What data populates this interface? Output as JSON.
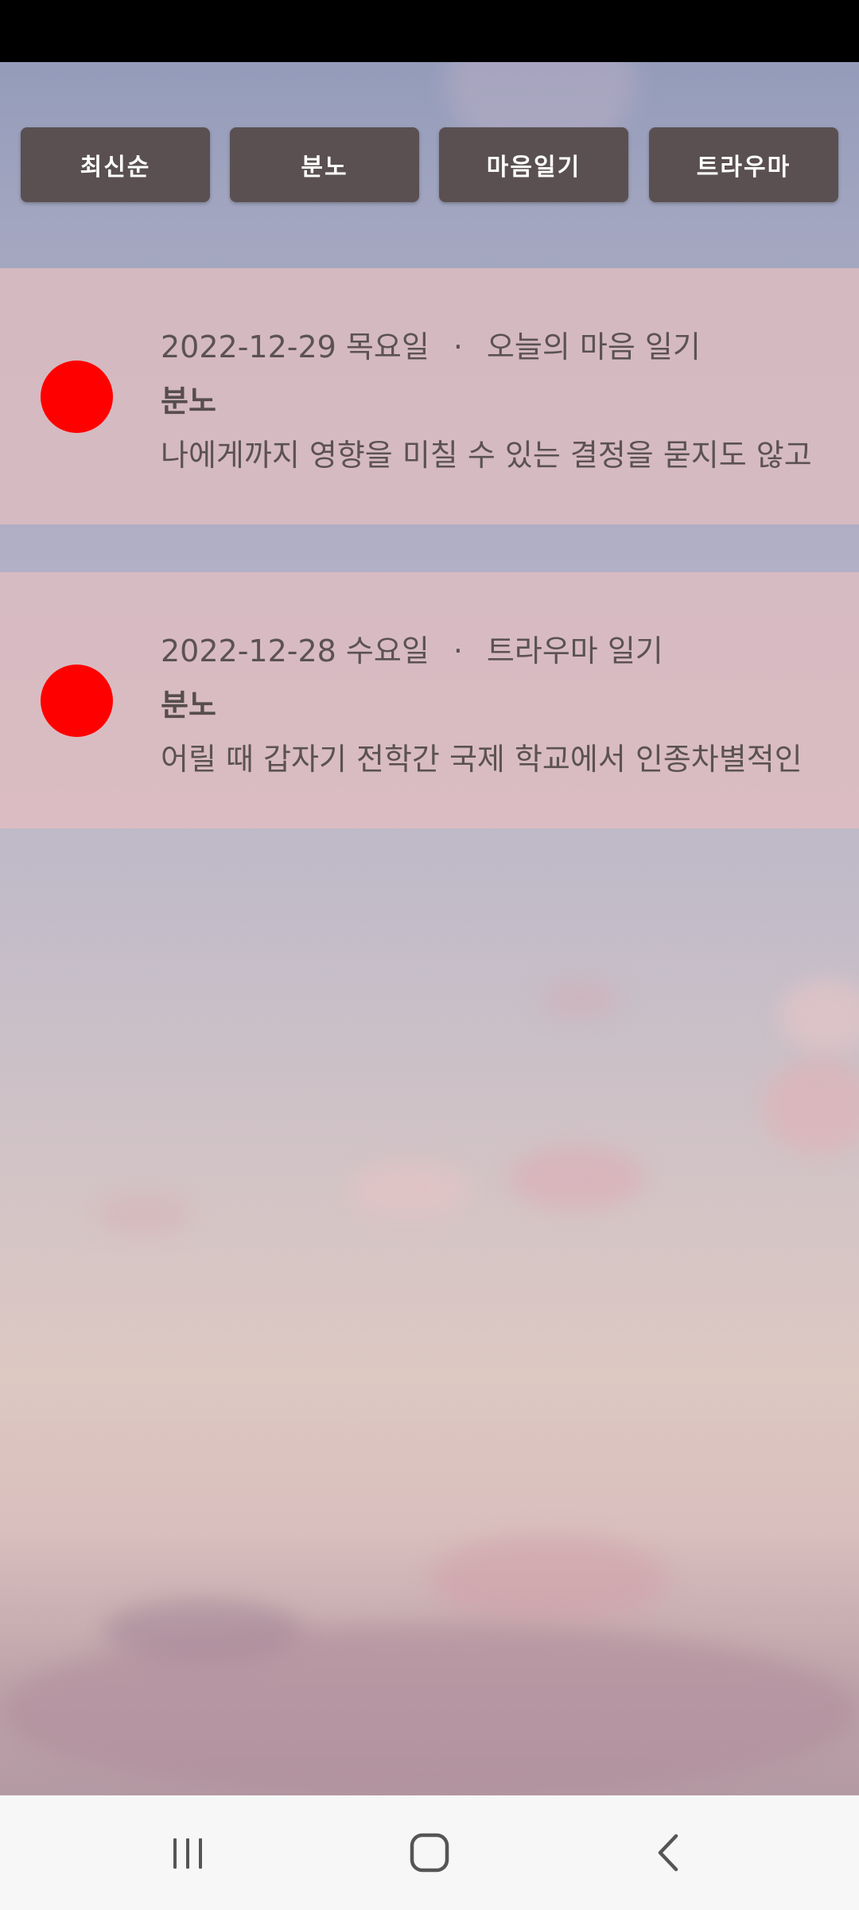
{
  "filters": [
    {
      "label": "최신순"
    },
    {
      "label": "분노"
    },
    {
      "label": "마음일기"
    },
    {
      "label": "트라우마"
    }
  ],
  "separator": "·",
  "entries": [
    {
      "date": "2022-12-29 목요일",
      "diary_type": "오늘의 마음 일기",
      "emotion": "분노",
      "emotion_color": "#ff0000",
      "preview": "나에게까지 영향을 미칠 수 있는 결정을 묻지도 않고"
    },
    {
      "date": "2022-12-28 수요일",
      "diary_type": "트라우마 일기",
      "emotion": "분노",
      "emotion_color": "#ff0000",
      "preview": "어릴 때 갑자기 전학간 국제 학교에서 인종차별적인"
    }
  ],
  "navigation": {
    "recent_icon": "recent-apps-icon",
    "home_icon": "home-icon",
    "back_icon": "back-icon"
  }
}
